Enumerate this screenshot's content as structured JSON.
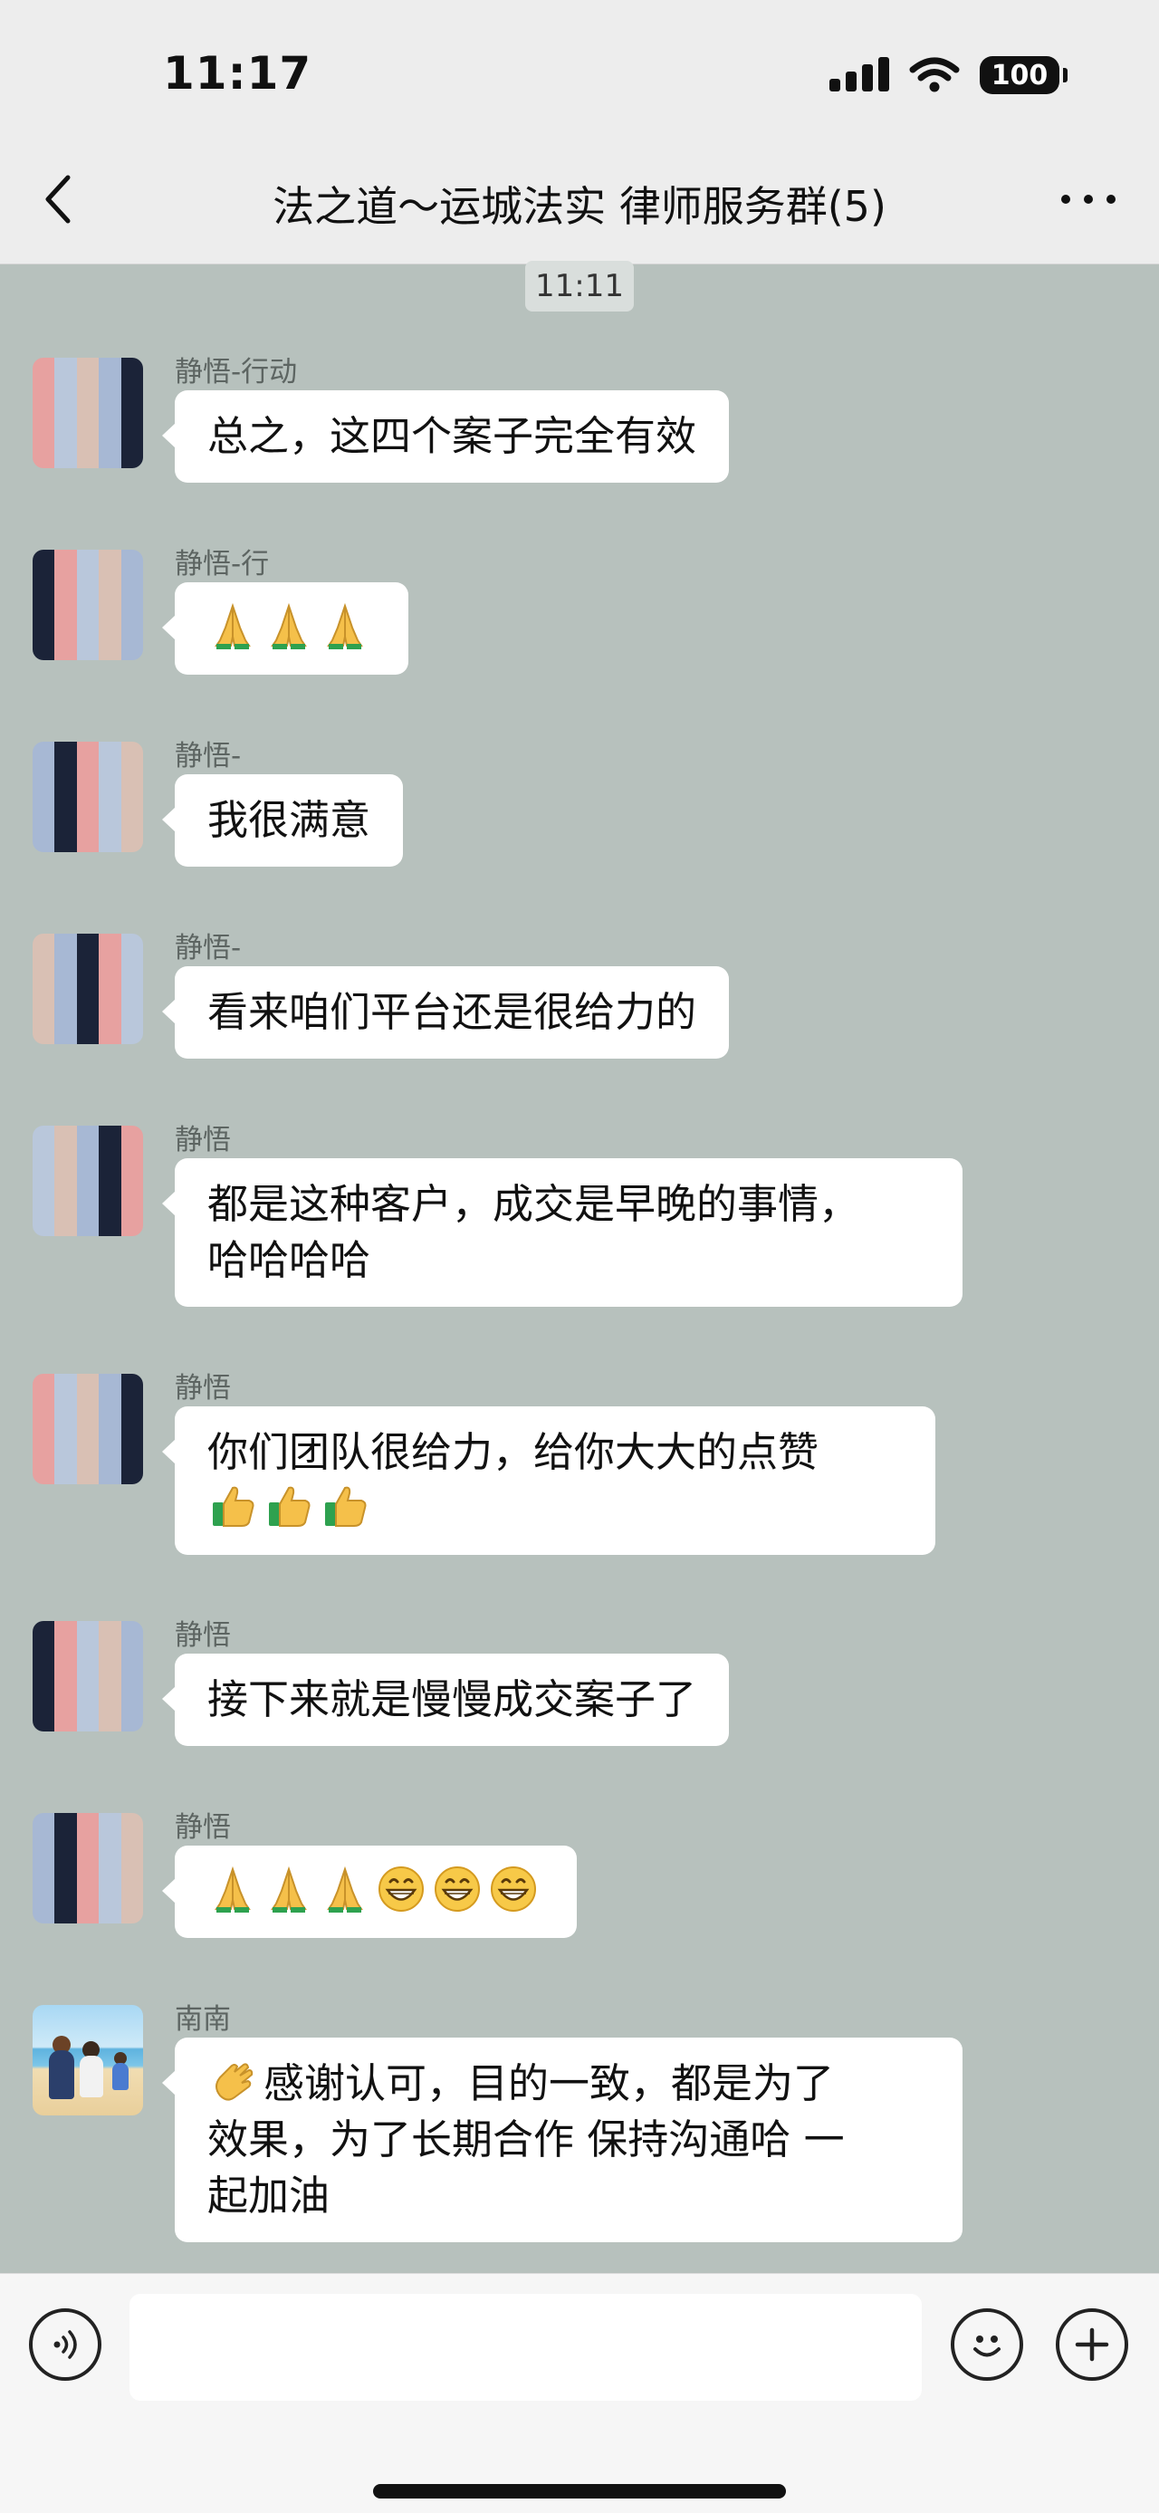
{
  "status_bar": {
    "time": "11:17",
    "battery": "100"
  },
  "nav": {
    "title": "法之道～运城法实 律师服务群(5)"
  },
  "divider": {
    "time": "11:11"
  },
  "messages": [
    {
      "sender": "静悟-行动",
      "lines": [
        "总之，这四个案子完全有效"
      ]
    },
    {
      "sender": "静悟-行",
      "lines": [
        ""
      ],
      "emoji_after": [
        "pray",
        "pray",
        "pray"
      ]
    },
    {
      "sender": "静悟-",
      "lines": [
        "我很满意"
      ]
    },
    {
      "sender": "静悟-",
      "lines": [
        "看来咱们平台还是很给力的"
      ]
    },
    {
      "sender": "静悟",
      "lines": [
        "都是这种客户，成交是早晚的事情，",
        "哈哈哈哈"
      ]
    },
    {
      "sender": "静悟",
      "lines": [
        "你们团队很给力，给你大大的点赞"
      ],
      "emoji_line": [
        "thumb",
        "thumb",
        "thumb"
      ]
    },
    {
      "sender": "静悟",
      "lines": [
        "接下来就是慢慢成交案子了"
      ]
    },
    {
      "sender": "静悟",
      "lines": [
        ""
      ],
      "emoji_after": [
        "pray",
        "pray",
        "pray",
        "grin",
        "grin",
        "grin"
      ]
    },
    {
      "sender": "南南",
      "lines": [
        "感谢认可，目的一致，都是为了",
        "效果，为了长期合作 保持沟通哈 一",
        "起加油"
      ]
    }
  ],
  "icons": {
    "back": "chevron-left-icon",
    "more": "more-dots-icon",
    "voice": "voice-icon",
    "emoji": "smiley-icon",
    "plus": "plus-icon",
    "pray": "folded-hands-emoji",
    "thumb": "thumbs-up-emoji",
    "grin": "grinning-face-emoji",
    "wave": "waving-hand-emoji"
  },
  "colors": {
    "chat_background": "#b7c1bd",
    "bubble": "#ffffff",
    "bar": "#ededed"
  }
}
